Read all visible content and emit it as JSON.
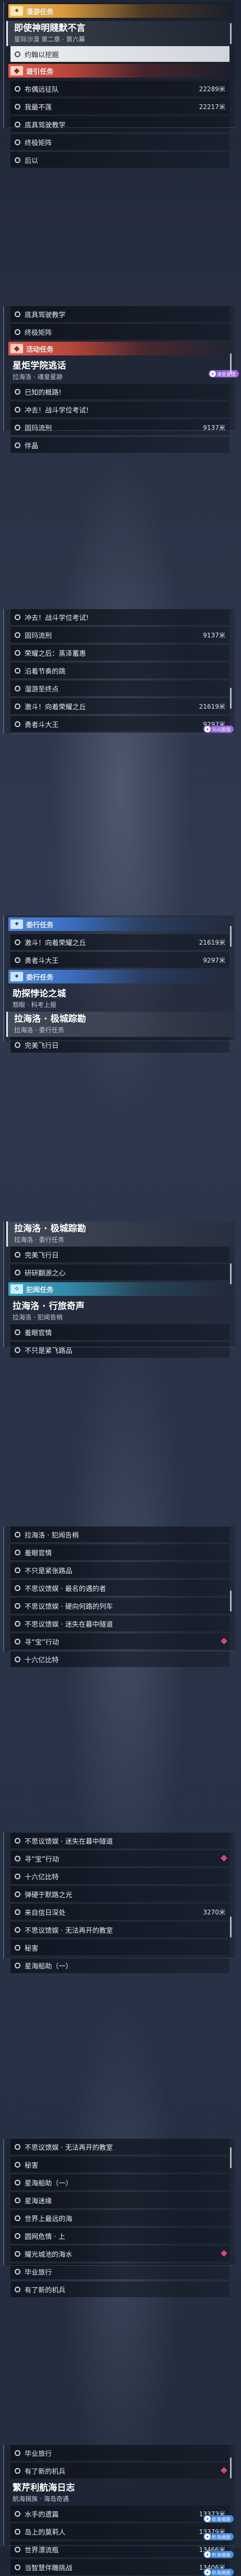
{
  "shots": [
    {
      "blocks": [
        {
          "t": "cat",
          "style": "warm",
          "icon": "✦",
          "label": "漫游任务"
        },
        {
          "t": "head",
          "title": "即使神明賤默不言",
          "sub": "星际沙漠 第二章 · 第六幕",
          "sel": true
        },
        {
          "t": "step",
          "label": "约翰以挖掘",
          "hl": true
        },
        {
          "t": "cat",
          "style": "red",
          "icon": "◆",
          "label": "遊引任务"
        },
        {
          "t": "step",
          "label": "布偶远征队",
          "dist": "22289米"
        },
        {
          "t": "step",
          "label": "我最不莲",
          "dist": "22217米"
        },
        {
          "t": "step",
          "label": "底具驾驶教学"
        },
        {
          "t": "step",
          "label": "终极矩阵"
        },
        {
          "t": "step",
          "label": "后以"
        }
      ]
    },
    {
      "blocks": [
        {
          "t": "step",
          "label": "底具驾驶教学"
        },
        {
          "t": "step",
          "label": "终极矩阵"
        },
        {
          "t": "cat",
          "style": "red",
          "icon": "◆",
          "label": "活动任务"
        },
        {
          "t": "head",
          "title": "星炬学院逃话",
          "sub": "拉海洛 · 魂皇星跡",
          "badge": {
            "text": "遠星星塔",
            "color": "purple"
          }
        },
        {
          "t": "step",
          "label": "已知的概路!"
        },
        {
          "t": "step",
          "label": "冲去！战斗学位考试!"
        },
        {
          "t": "step",
          "label": "固玛流刑",
          "dist": "9137米"
        },
        {
          "t": "step",
          "label": "伴晶"
        }
      ]
    },
    {
      "blocks": [
        {
          "t": "step",
          "label": "冲去！战斗学位考试!"
        },
        {
          "t": "step",
          "label": "固玛流刑",
          "dist": "9137米"
        },
        {
          "t": "step",
          "label": "荣耀之后：蒸泽蓄惠"
        },
        {
          "t": "step",
          "label": "沿着节奏的跳"
        },
        {
          "t": "step",
          "label": "溜游至终点"
        },
        {
          "t": "step",
          "label": "激斗！向着荣耀之丘",
          "dist": "21619米"
        },
        {
          "t": "step",
          "label": "勇者斗大王",
          "dist": "9297米",
          "badge": {
            "text": "风间跟限",
            "color": "purple"
          }
        }
      ]
    },
    {
      "blocks": [
        {
          "t": "cat",
          "style": "blue",
          "icon": "✦",
          "label": "委行任务"
        },
        {
          "t": "step",
          "label": "激斗！向着荣耀之丘",
          "dist": "21619米"
        },
        {
          "t": "step",
          "label": "勇者斗大王",
          "dist": "9297米"
        },
        {
          "t": "cat",
          "style": "blue",
          "icon": "✦",
          "label": "委行任务"
        },
        {
          "t": "head",
          "title": "助探悖论之城",
          "sub": "颓眼 · 科考上报"
        },
        {
          "t": "head",
          "title": "拉海洛 · 极城踪勘",
          "sub": "拉海洛 · 委行任务",
          "sel": true
        },
        {
          "t": "step",
          "label": "完美飞行日"
        }
      ]
    },
    {
      "blocks": [
        {
          "t": "head",
          "title": "拉海洛 · 极城踪勘",
          "sub": "拉海洛 · 委行任务",
          "sel": true
        },
        {
          "t": "step",
          "label": "完美飞行日"
        },
        {
          "t": "step",
          "label": "研研翻源之心"
        },
        {
          "t": "cat",
          "style": "teal",
          "icon": "✧",
          "label": "犯闻任务"
        },
        {
          "t": "head",
          "title": "拉海洛 · 行旅奇声",
          "sub": "拉海洛 · 犯闻告梢"
        },
        {
          "t": "step",
          "label": "羞眼官情"
        },
        {
          "t": "step",
          "label": "不只是紧飞路品"
        }
      ]
    },
    {
      "blocks": [
        {
          "t": "step",
          "label": "拉海洛 · 犯闻告梢"
        },
        {
          "t": "step",
          "label": "羞眼官情"
        },
        {
          "t": "step",
          "label": "不只是紧张路品"
        },
        {
          "t": "step",
          "label": "不思议馈娱 · 最名的遇的者"
        },
        {
          "t": "step",
          "label": "不思议馈娱 · 硬向何路的列车"
        },
        {
          "t": "step",
          "label": "不思议馈娱 · 迷失在暮中隧道"
        },
        {
          "t": "step",
          "label": "寻“宝”行动",
          "diamond": true
        },
        {
          "t": "step",
          "label": "十六亿比特"
        }
      ]
    },
    {
      "blocks": [
        {
          "t": "step",
          "label": "不思议馈娱 · 迷失在暮中隧道"
        },
        {
          "t": "step",
          "label": "寻“宝”行动",
          "diamond": true
        },
        {
          "t": "step",
          "label": "十六亿比特"
        },
        {
          "t": "step",
          "label": "弹硬于默路之光"
        },
        {
          "t": "step",
          "label": "来自信日深处",
          "dist": "3270米"
        },
        {
          "t": "step",
          "label": "不思议馈娱 · 无法再开的教室"
        },
        {
          "t": "step",
          "label": "秘害"
        },
        {
          "t": "step",
          "label": "星海船助（一）"
        }
      ]
    },
    {
      "blocks": [
        {
          "t": "step",
          "label": "不思议馈娱 · 无法再开的教室"
        },
        {
          "t": "step",
          "label": "秘害"
        },
        {
          "t": "step",
          "label": "星海船助（一）"
        },
        {
          "t": "step",
          "label": "星海迷缘"
        },
        {
          "t": "step",
          "label": "世界上最远的海"
        },
        {
          "t": "step",
          "label": "圆网危情 · 上"
        },
        {
          "t": "step",
          "label": "耀光城池的海水",
          "diamond": true
        },
        {
          "t": "step",
          "label": "毕业旅行"
        },
        {
          "t": "step",
          "label": "有了新的机兵"
        }
      ]
    },
    {
      "blocks": [
        {
          "t": "step",
          "label": "毕业旅行"
        },
        {
          "t": "step",
          "label": "有了新的机兵",
          "diamond": true
        },
        {
          "t": "head",
          "title": "繁芹利航海日志",
          "sub": "航海揖族 · 海岛奇遇"
        },
        {
          "t": "step",
          "label": "水手的遗篇",
          "dist": "13373米",
          "badge": {
            "text": "航海揖族",
            "color": "blue"
          }
        },
        {
          "t": "step",
          "label": "岛上的莫莉人",
          "dist": "13379米",
          "badge": {
            "text": "航海揖族",
            "color": "blue"
          }
        },
        {
          "t": "step",
          "label": "世界漂流瓶",
          "dist": "13466米",
          "badge": {
            "text": "航海揖族",
            "color": "blue"
          }
        },
        {
          "t": "step",
          "label": "当智慧伴雕挑战",
          "dist": "13406米",
          "badge": {
            "text": "航海揖族",
            "color": "blue"
          }
        }
      ]
    }
  ]
}
